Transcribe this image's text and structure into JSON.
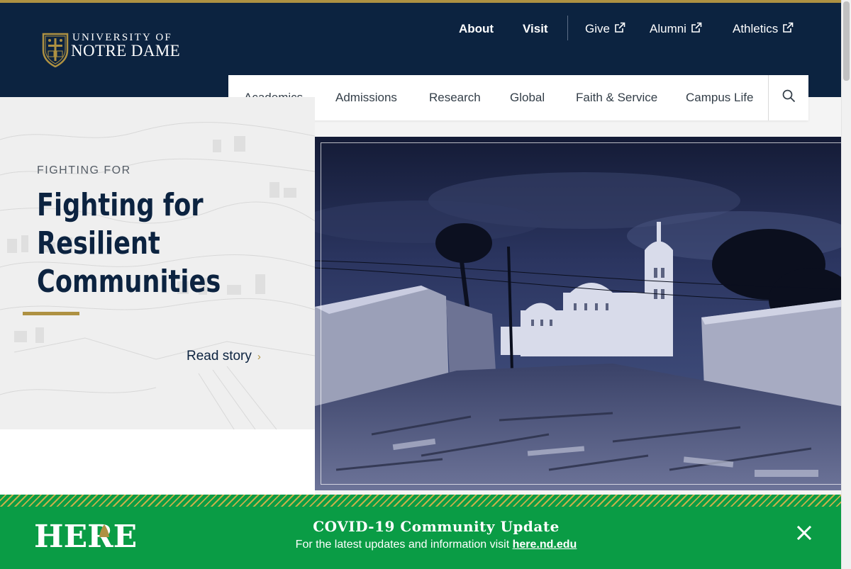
{
  "header": {
    "logo": {
      "line1": "UNIVERSITY OF",
      "line2": "NOTRE DAME",
      "icon": "nd-shield-icon"
    },
    "utility_nav": [
      {
        "label": "About",
        "external": false
      },
      {
        "label": "Visit",
        "external": false
      },
      {
        "label": "Give",
        "external": true
      },
      {
        "label": "Alumni",
        "external": true
      },
      {
        "label": "Athletics",
        "external": true
      }
    ],
    "main_nav": [
      {
        "label": "Academics"
      },
      {
        "label": "Admissions"
      },
      {
        "label": "Research"
      },
      {
        "label": "Global"
      },
      {
        "label": "Faith & Service"
      },
      {
        "label": "Campus Life"
      }
    ],
    "search_icon": "search-icon"
  },
  "hero": {
    "eyebrow": "FIGHTING FOR",
    "title_lines": [
      "Fighting for",
      "Resilient",
      "Communities"
    ],
    "cta": "Read story",
    "cta_icon": "chevron-right-icon"
  },
  "covid_banner": {
    "logo_text": "HERE",
    "title": "COVID-19 Community Update",
    "message": "For the latest updates and information visit",
    "link_text": "here.nd.edu",
    "close_icon": "close-icon"
  },
  "colors": {
    "navy": "#0c2340",
    "gold": "#ae9142",
    "green": "#0a9c45"
  }
}
